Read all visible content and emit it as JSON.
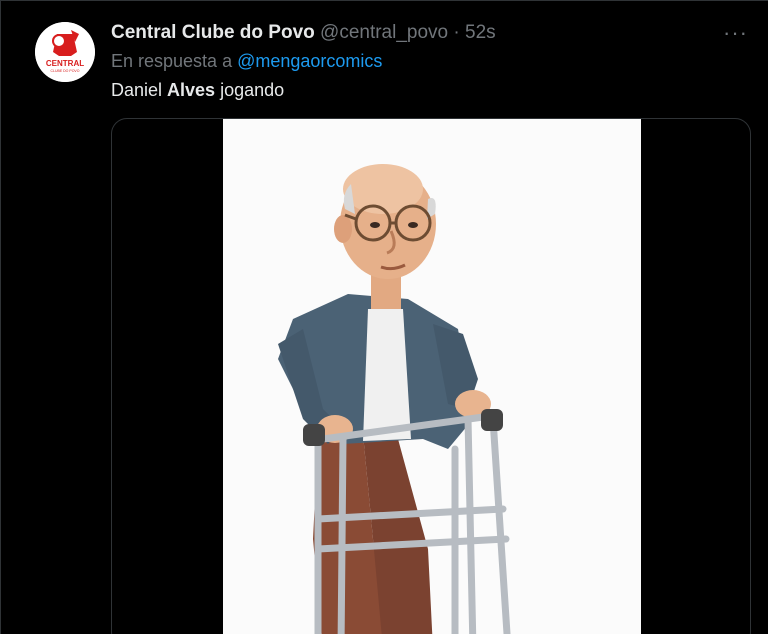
{
  "tweet": {
    "display_name": "Central Clube do Povo",
    "handle": "@central_povo",
    "separator": "·",
    "time": "52s",
    "more_label": "···",
    "reply_prefix": "En respuesta a",
    "reply_mention": "@mengaorcomics",
    "text_before": "Daniel ",
    "text_bold": "Alves",
    "text_after": " jogando"
  },
  "avatar": {
    "logo_text": "CENTRAL",
    "logo_subtext": "CLUBE DO POVO",
    "accent": "#d81e1e"
  },
  "media": {
    "type": "animated-gif",
    "description_icon": "old-man-with-walker-image"
  },
  "colors": {
    "background": "#000000",
    "text": "#e7e9ea",
    "secondary": "#71767b",
    "link": "#1d9bf0",
    "border": "#2f3336"
  }
}
